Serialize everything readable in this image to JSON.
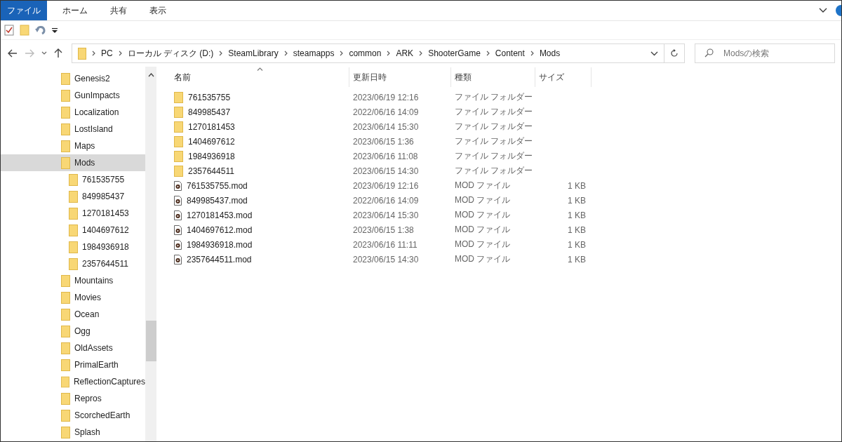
{
  "ribbon_tabs": [
    {
      "label": "ファイル",
      "selected": true
    },
    {
      "label": "ホーム",
      "selected": false
    },
    {
      "label": "共有",
      "selected": false
    },
    {
      "label": "表示",
      "selected": false
    }
  ],
  "address_bar": {
    "path": [
      "PC",
      "ローカル ディスク (D:)",
      "SteamLibrary",
      "steamapps",
      "common",
      "ARK",
      "ShooterGame",
      "Content",
      "Mods"
    ]
  },
  "search": {
    "placeholder": "Modsの検索"
  },
  "sidebar": {
    "items": [
      {
        "label": "Genesis2",
        "selected": false
      },
      {
        "label": "GunImpacts",
        "selected": false
      },
      {
        "label": "Localization",
        "selected": false
      },
      {
        "label": "LostIsland",
        "selected": false
      },
      {
        "label": "Maps",
        "selected": false
      },
      {
        "label": "Mods",
        "selected": true,
        "children": [
          {
            "label": "761535755",
            "selected": false
          },
          {
            "label": "849985437",
            "selected": false
          },
          {
            "label": "1270181453",
            "selected": false
          },
          {
            "label": "1404697612",
            "selected": false
          },
          {
            "label": "1984936918",
            "selected": false
          },
          {
            "label": "2357644511",
            "selected": false
          }
        ]
      },
      {
        "label": "Mountains",
        "selected": false
      },
      {
        "label": "Movies",
        "selected": false
      },
      {
        "label": "Ocean",
        "selected": false
      },
      {
        "label": "Ogg",
        "selected": false
      },
      {
        "label": "OldAssets",
        "selected": false
      },
      {
        "label": "PrimalEarth",
        "selected": false
      },
      {
        "label": "ReflectionCaptures",
        "selected": false
      },
      {
        "label": "Repros",
        "selected": false
      },
      {
        "label": "ScorchedEarth",
        "selected": false
      },
      {
        "label": "Splash",
        "selected": false
      }
    ]
  },
  "table": {
    "columns": [
      "名前",
      "更新日時",
      "種類",
      "サイズ"
    ],
    "rows": [
      {
        "kind": "folder",
        "name": "761535755",
        "modified": "2023/06/19 12:16",
        "type": "ファイル フォルダー"
      },
      {
        "kind": "folder",
        "name": "849985437",
        "modified": "2022/06/16 14:09",
        "type": "ファイル フォルダー"
      },
      {
        "kind": "folder",
        "name": "1270181453",
        "modified": "2023/06/14 15:30",
        "type": "ファイル フォルダー"
      },
      {
        "kind": "folder",
        "name": "1404697612",
        "modified": "2023/06/15 1:36",
        "type": "ファイル フォルダー"
      },
      {
        "kind": "folder",
        "name": "1984936918",
        "modified": "2023/06/16 11:08",
        "type": "ファイル フォルダー"
      },
      {
        "kind": "folder",
        "name": "2357644511",
        "modified": "2023/06/15 14:30",
        "type": "ファイル フォルダー"
      },
      {
        "kind": "file",
        "name": "761535755.mod",
        "modified": "2023/06/19 12:16",
        "type": "MOD ファイル",
        "size": "1 KB"
      },
      {
        "kind": "file",
        "name": "849985437.mod",
        "modified": "2022/06/16 14:09",
        "type": "MOD ファイル",
        "size": "1 KB"
      },
      {
        "kind": "file",
        "name": "1270181453.mod",
        "modified": "2023/06/14 15:30",
        "type": "MOD ファイル",
        "size": "1 KB"
      },
      {
        "kind": "file",
        "name": "1404697612.mod",
        "modified": "2023/06/15 1:38",
        "type": "MOD ファイル",
        "size": "1 KB"
      },
      {
        "kind": "file",
        "name": "1984936918.mod",
        "modified": "2023/06/16 11:11",
        "type": "MOD ファイル",
        "size": "1 KB"
      },
      {
        "kind": "file",
        "name": "2357644511.mod",
        "modified": "2023/06/15 14:30",
        "type": "MOD ファイル",
        "size": "1 KB"
      }
    ]
  }
}
